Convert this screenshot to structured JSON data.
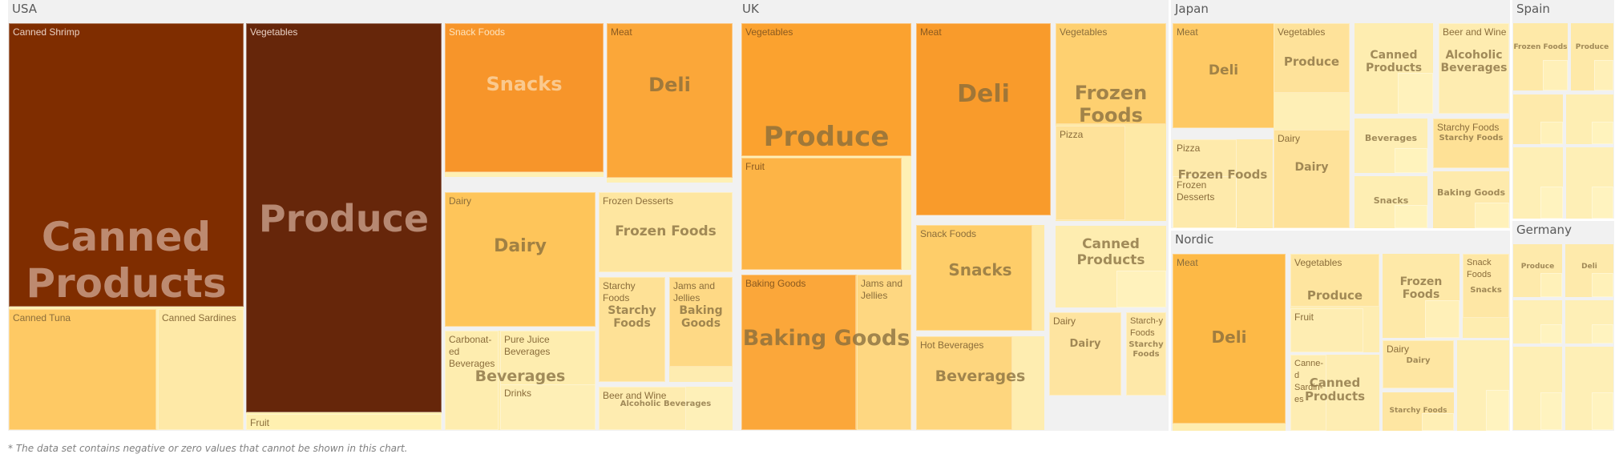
{
  "chart_data": {
    "type": "treemap",
    "title": "",
    "footnote": "* The data set contains negative or zero values that cannot be shown in this chart.",
    "color_scale": {
      "low": "#fff3b8",
      "mid": "#fdb846",
      "high_orange": "#f7952a",
      "dark": "#7f2d00",
      "darkest": "#66260a"
    },
    "groups": [
      {
        "name": "USA",
        "tiles": [
          {
            "id": "usa-canned",
            "category": "Canned Products",
            "category_size": "xl",
            "value": 10,
            "leaves": [
              {
                "id": "usa-canned-shrimp",
                "label": "Canned Shrimp",
                "value": 10
              },
              {
                "id": "usa-canned-tuna",
                "label": "Canned Tuna",
                "value": 4
              },
              {
                "id": "usa-canned-sardines",
                "label": "Canned Sardines",
                "value": 1
              }
            ]
          },
          {
            "id": "usa-produce",
            "category": "Produce",
            "category_size": "xl",
            "value": 10,
            "leaves": [
              {
                "id": "usa-produce-veg",
                "label": "Vegetables",
                "value": 10.5
              },
              {
                "id": "usa-produce-fruit",
                "label": "Fruit",
                "value": 1
              }
            ]
          },
          {
            "id": "usa-snacks",
            "category": "Snacks",
            "category_size": "l",
            "value": 6,
            "leaves": [
              {
                "id": "usa-snack-foods",
                "label": "Snack Foods",
                "value": 6
              }
            ]
          },
          {
            "id": "usa-deli",
            "category": "Deli",
            "category_size": "l",
            "value": 5.5,
            "leaves": [
              {
                "id": "usa-meat",
                "label": "Meat",
                "value": 5.5
              }
            ]
          },
          {
            "id": "usa-dairy",
            "category": "Dairy",
            "category_size": "l",
            "value": 4.5,
            "leaves": [
              {
                "id": "usa-dairy-leaf",
                "label": "Dairy",
                "value": 4.5
              }
            ]
          },
          {
            "id": "usa-frozen",
            "category": "Frozen Foods",
            "category_size": "m",
            "value": 2,
            "leaves": [
              {
                "id": "usa-frozen-desserts",
                "label": "Frozen Desserts",
                "value": 2
              }
            ]
          },
          {
            "id": "usa-starchy",
            "category": "Starchy Foods",
            "category_size": "m",
            "value": 2,
            "leaves": [
              {
                "id": "usa-starchy-leaf",
                "label": "Starchy Foods",
                "value": 2
              }
            ]
          },
          {
            "id": "usa-baking",
            "category": "Baking Goods",
            "category_size": "m",
            "value": 3,
            "leaves": [
              {
                "id": "usa-jams",
                "label": "Jams and Jellies",
                "value": 3
              }
            ]
          },
          {
            "id": "usa-beverages",
            "category": "Beverages",
            "category_size": "m",
            "value": 1.5,
            "leaves": [
              {
                "id": "usa-carbonated",
                "label": "Carbonated Beverages",
                "label_display": "Carbonat-ed Beverages",
                "value": 1.5
              },
              {
                "id": "usa-pure-juice",
                "label": "Pure Juice Beverages",
                "value": 1.5
              },
              {
                "id": "usa-drinks",
                "label": "Drinks",
                "value": 1
              }
            ]
          },
          {
            "id": "usa-alcoholic",
            "category": "Alcoholic Beverages",
            "category_size": "s",
            "value": 1,
            "leaves": [
              {
                "id": "usa-beer-wine",
                "label": "Beer and Wine",
                "value": 1
              }
            ]
          }
        ]
      },
      {
        "name": "UK",
        "tiles": [
          {
            "id": "uk-produce",
            "category": "Produce",
            "category_size": "l",
            "value": 6,
            "leaves": [
              {
                "id": "uk-veg",
                "label": "Vegetables",
                "value": 6
              },
              {
                "id": "uk-fruit",
                "label": "Fruit",
                "value": 5
              }
            ]
          },
          {
            "id": "uk-deli",
            "category": "Deli",
            "category_size": "l",
            "value": 6,
            "leaves": [
              {
                "id": "uk-meat",
                "label": "Meat",
                "value": 6
              }
            ]
          },
          {
            "id": "uk-frozen",
            "category": "Frozen Foods",
            "category_size": "l",
            "value": 3,
            "leaves": [
              {
                "id": "uk-frozen-veg",
                "label": "Vegetables",
                "value": 3
              },
              {
                "id": "uk-pizza",
                "label": "Pizza",
                "value": 2
              }
            ]
          },
          {
            "id": "uk-baking",
            "category": "Baking Goods",
            "category_size": "l",
            "value": 5,
            "leaves": [
              {
                "id": "uk-baking-leaf",
                "label": "Baking Goods",
                "value": 5
              },
              {
                "id": "uk-jams",
                "label": "Jams and Jellies",
                "value": 3
              }
            ]
          },
          {
            "id": "uk-snacks",
            "category": "Snacks",
            "category_size": "m",
            "value": 3.5,
            "leaves": [
              {
                "id": "uk-snack-foods",
                "label": "Snack Foods",
                "value": 3.5
              }
            ]
          },
          {
            "id": "uk-canned",
            "category": "Canned Products",
            "category_size": "m",
            "value": 1.5,
            "leaves": []
          },
          {
            "id": "uk-beverages",
            "category": "Beverages",
            "category_size": "m",
            "value": 3,
            "leaves": [
              {
                "id": "uk-hot-bev",
                "label": "Hot Beverages",
                "value": 3
              }
            ]
          },
          {
            "id": "uk-dairy",
            "category": "Dairy",
            "category_size": "s",
            "value": 2,
            "leaves": [
              {
                "id": "uk-dairy-leaf",
                "label": "Dairy",
                "value": 2
              }
            ]
          },
          {
            "id": "uk-starchy",
            "category": "Starchy Foods",
            "category_size": "xs",
            "value": 1.5,
            "leaves": [
              {
                "id": "uk-starchy-leaf",
                "label": "Starchy Foods",
                "label_display": "Starch-y Foods",
                "value": 1.5
              }
            ]
          }
        ]
      },
      {
        "name": "Japan",
        "tiles": [
          {
            "id": "jp-deli",
            "category": "Deli",
            "category_size": "m",
            "value": 4,
            "leaves": [
              {
                "id": "jp-meat",
                "label": "Meat",
                "value": 4
              }
            ]
          },
          {
            "id": "jp-produce",
            "category": "Produce",
            "category_size": "s",
            "value": 2,
            "leaves": [
              {
                "id": "jp-veg",
                "label": "Vegetables",
                "value": 2
              }
            ]
          },
          {
            "id": "jp-canned",
            "category": "Canned Products",
            "category_size": "s",
            "value": 1,
            "leaves": []
          },
          {
            "id": "jp-alcoholic",
            "category": "Alcoholic Beverages",
            "category_size": "s",
            "value": 1.5,
            "leaves": [
              {
                "id": "jp-beer-wine",
                "label": "Beer and Wine",
                "value": 1.5
              }
            ]
          },
          {
            "id": "jp-frozen",
            "category": "Frozen Foods",
            "category_size": "s",
            "value": 1.5,
            "leaves": [
              {
                "id": "jp-pizza",
                "label": "Pizza",
                "value": 1.5
              },
              {
                "id": "jp-frozen-desserts",
                "label": "Frozen Desserts",
                "value": 1
              }
            ]
          },
          {
            "id": "jp-dairy",
            "category": "Dairy",
            "category_size": "s",
            "value": 2,
            "leaves": [
              {
                "id": "jp-dairy-leaf",
                "label": "Dairy",
                "value": 2
              }
            ]
          },
          {
            "id": "jp-beverages",
            "category": "Beverages",
            "category_size": "xs",
            "value": 1,
            "leaves": []
          },
          {
            "id": "jp-starchy",
            "category": "Starchy Foods",
            "category_size": "xs",
            "value": 1.5,
            "leaves": [
              {
                "id": "jp-starchy-leaf",
                "label": "Starchy Foods",
                "value": 1.5
              }
            ]
          },
          {
            "id": "jp-snacks",
            "category": "Snacks",
            "category_size": "xs",
            "value": 1,
            "leaves": []
          },
          {
            "id": "jp-baking",
            "category": "Baking Goods",
            "category_size": "xs",
            "value": 1,
            "leaves": []
          }
        ]
      },
      {
        "name": "Nordic",
        "tiles": [
          {
            "id": "nd-deli",
            "category": "Deli",
            "category_size": "m",
            "value": 5,
            "leaves": [
              {
                "id": "nd-meat",
                "label": "Meat",
                "value": 5
              }
            ]
          },
          {
            "id": "nd-produce",
            "category": "Produce",
            "category_size": "s",
            "value": 2,
            "leaves": [
              {
                "id": "nd-veg",
                "label": "Vegetables",
                "value": 2
              },
              {
                "id": "nd-fruit",
                "label": "Fruit",
                "value": 1
              }
            ]
          },
          {
            "id": "nd-canned",
            "category": "Canned Products",
            "category_size": "s",
            "value": 1,
            "leaves": [
              {
                "id": "nd-canned-sardines",
                "label": "Canned Sardines",
                "label_display": "Canne-d Sardin-es",
                "value": 1
              }
            ]
          },
          {
            "id": "nd-frozen",
            "category": "Frozen Foods",
            "category_size": "s",
            "value": 1.5,
            "leaves": []
          },
          {
            "id": "nd-snacks",
            "category": "Snacks",
            "category_size": "xs",
            "value": 1,
            "leaves": [
              {
                "id": "nd-snack-foods",
                "label": "Snack Foods",
                "value": 1
              }
            ]
          },
          {
            "id": "nd-dairy",
            "category": "Dairy",
            "category_size": "xs",
            "value": 1.5,
            "leaves": [
              {
                "id": "nd-dairy-leaf",
                "label": "Dairy",
                "value": 1.5
              }
            ]
          },
          {
            "id": "nd-starchy",
            "category": "Starchy Foods",
            "category_size": "xs",
            "value": 1.5,
            "leaves": []
          },
          {
            "id": "nd-other",
            "category": "",
            "category_size": "xs",
            "value": 0.5,
            "leaves": []
          }
        ]
      },
      {
        "name": "Spain",
        "tiles": [
          {
            "id": "es-frozen",
            "category": "Frozen Foods",
            "category_size": "xs",
            "value": 1.2,
            "leaves": []
          },
          {
            "id": "es-produce",
            "category": "Produce",
            "category_size": "xs",
            "value": 1.2,
            "leaves": []
          },
          {
            "id": "es-a",
            "category": "",
            "category_size": "xs",
            "value": 1,
            "leaves": []
          },
          {
            "id": "es-b",
            "category": "",
            "category_size": "xs",
            "value": 1,
            "leaves": []
          },
          {
            "id": "es-c",
            "category": "",
            "category_size": "xs",
            "value": 0.6,
            "leaves": []
          },
          {
            "id": "es-d",
            "category": "",
            "category_size": "xs",
            "value": 0.6,
            "leaves": []
          }
        ]
      },
      {
        "name": "Germany",
        "tiles": [
          {
            "id": "de-produce",
            "category": "Produce",
            "category_size": "xs",
            "value": 1,
            "leaves": []
          },
          {
            "id": "de-deli",
            "category": "Deli",
            "category_size": "xs",
            "value": 1,
            "leaves": []
          },
          {
            "id": "de-a",
            "category": "",
            "category_size": "xs",
            "value": 0.6,
            "leaves": []
          },
          {
            "id": "de-b",
            "category": "",
            "category_size": "xs",
            "value": 0.6,
            "leaves": []
          },
          {
            "id": "de-c",
            "category": "",
            "category_size": "xs",
            "value": 0.5,
            "leaves": []
          },
          {
            "id": "de-d",
            "category": "",
            "category_size": "xs",
            "value": 0.5,
            "leaves": []
          }
        ]
      }
    ]
  }
}
